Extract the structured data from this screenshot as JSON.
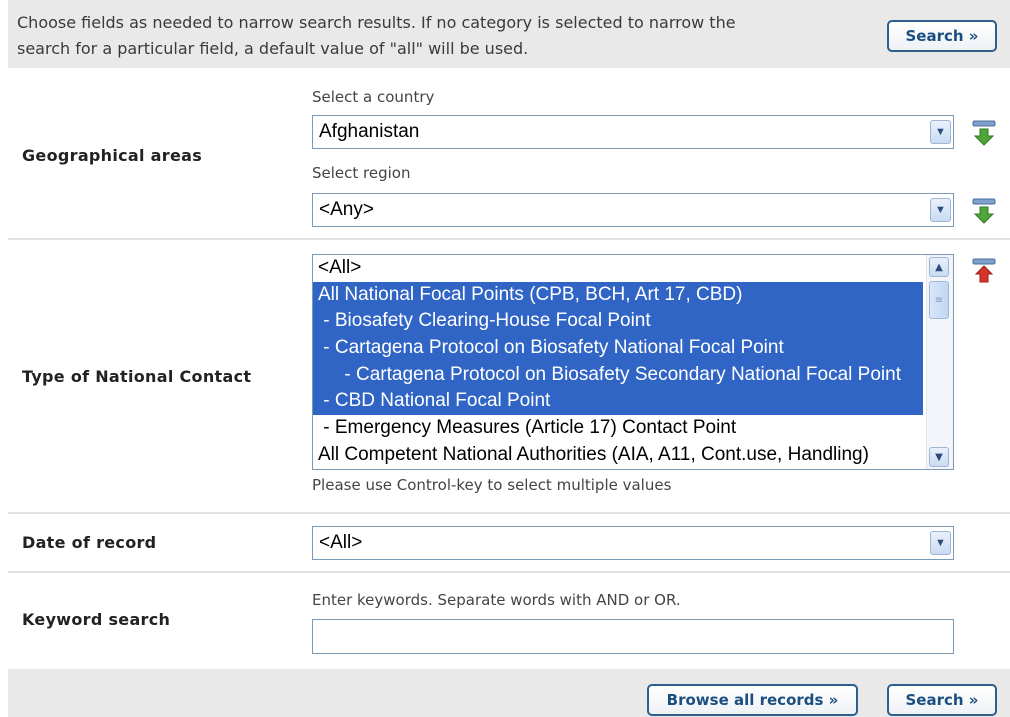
{
  "intro": {
    "line1": "Choose fields as needed to narrow search results. If no category is selected to narrow the",
    "line2": "search for a particular field, a default value of \"all\" will be used."
  },
  "buttons": {
    "search_top": "Search »",
    "browse_all": "Browse all records »",
    "search_bottom": "Search »"
  },
  "geo": {
    "label": "Geographical areas",
    "country_hint": "Select a country",
    "country_value": "Afghanistan",
    "region_hint": "Select region",
    "region_value": "<Any>"
  },
  "contact": {
    "label": "Type of National Contact",
    "options": [
      {
        "text": "<All>",
        "selected": false
      },
      {
        "text": "All National Focal Points (CPB, BCH, Art 17, CBD)",
        "selected": true
      },
      {
        "text": " - Biosafety Clearing-House Focal Point",
        "selected": true
      },
      {
        "text": " - Cartagena Protocol on Biosafety National Focal Point",
        "selected": true
      },
      {
        "text": "     - Cartagena Protocol on Biosafety Secondary National Focal Point",
        "selected": true
      },
      {
        "text": " - CBD National Focal Point",
        "selected": true
      },
      {
        "text": " - Emergency Measures (Article 17) Contact Point",
        "selected": false
      },
      {
        "text": "All Competent National Authorities (AIA, A11, Cont.use, Handling)",
        "selected": false
      }
    ],
    "hint": "Please use Control-key to select multiple values"
  },
  "date": {
    "label": "Date of record",
    "value": "<All>"
  },
  "keyword": {
    "label": "Keyword search",
    "hint": "Enter keywords. Separate words with AND or OR.",
    "value": ""
  },
  "colors": {
    "selected_bg": "#3065c6",
    "button_border": "#2d5f8a",
    "button_text": "#1c4f7f",
    "bar_bg": "#e9e9e9"
  },
  "icons": {
    "country_add": "green-down-arrow-icon",
    "region_add": "green-down-arrow-icon",
    "contact_remove": "red-up-arrow-icon"
  }
}
